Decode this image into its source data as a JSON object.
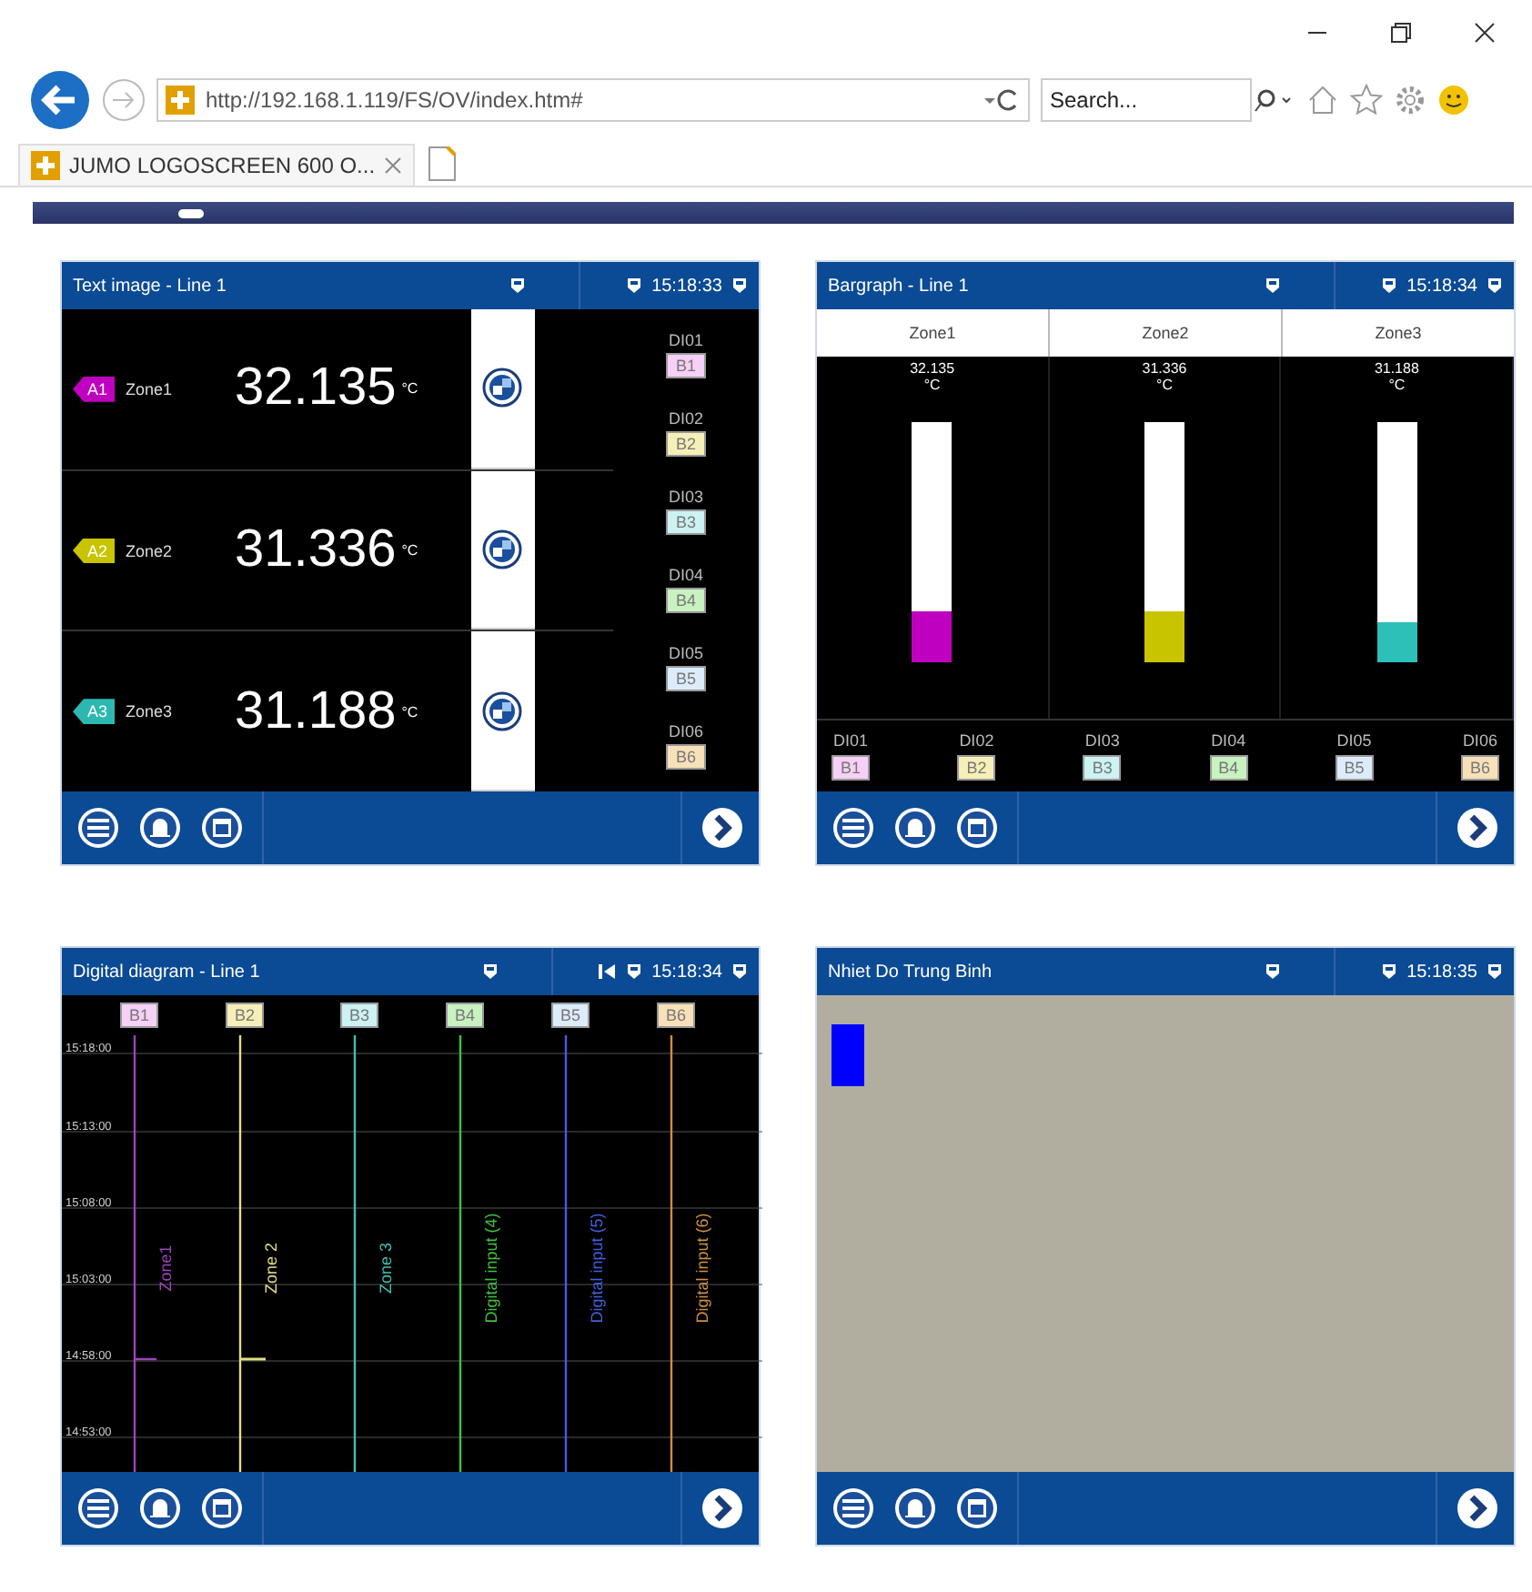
{
  "browser": {
    "url": "http://192.168.1.119/FS/OV/index.htm#",
    "search_placeholder": "Search...",
    "tab_title": "JUMO LOGOSCREEN 600 O..."
  },
  "panels": [
    {
      "kind": "text_image",
      "title": "Text image - Line 1",
      "time": "15:18:33",
      "skip_back": false,
      "rows": [
        {
          "tag": "A1",
          "name": "Zone1",
          "value": "32.135",
          "unit": "°C",
          "color": "#c000c0"
        },
        {
          "tag": "A2",
          "name": "Zone2",
          "value": "31.336",
          "unit": "°C",
          "color": "#c8c400"
        },
        {
          "tag": "A3",
          "name": "Zone3",
          "value": "31.188",
          "unit": "°C",
          "color": "#2cb8b0"
        }
      ],
      "inputs": [
        {
          "label": "DI01",
          "tag": "B1",
          "color": "#f6d0f6"
        },
        {
          "label": "DI02",
          "tag": "B2",
          "color": "#f6f0b8"
        },
        {
          "label": "DI03",
          "tag": "B3",
          "color": "#ccf2f2"
        },
        {
          "label": "DI04",
          "tag": "B4",
          "color": "#c8f2c0"
        },
        {
          "label": "DI05",
          "tag": "B5",
          "color": "#dcecfa"
        },
        {
          "label": "DI06",
          "tag": "B6",
          "color": "#f8e0b8"
        }
      ]
    },
    {
      "kind": "bargraph",
      "title": "Bargraph - Line 1",
      "time": "15:18:34",
      "skip_back": false,
      "zones": [
        {
          "name": "Zone1",
          "value": "32.135",
          "unit": "°C",
          "level": 0.21,
          "color": "#c000c0"
        },
        {
          "name": "Zone2",
          "value": "31.336",
          "unit": "°C",
          "level": 0.21,
          "color": "#c8c400"
        },
        {
          "name": "Zone3",
          "value": "31.188",
          "unit": "°C",
          "level": 0.17,
          "color": "#2cc0b8"
        }
      ],
      "inputs": [
        {
          "label": "DI01",
          "tag": "B1",
          "color": "#f6d0f6"
        },
        {
          "label": "DI02",
          "tag": "B2",
          "color": "#f6f0b8"
        },
        {
          "label": "DI03",
          "tag": "B3",
          "color": "#ccf2f2"
        },
        {
          "label": "DI04",
          "tag": "B4",
          "color": "#c8f2c0"
        },
        {
          "label": "DI05",
          "tag": "B5",
          "color": "#dcecfa"
        },
        {
          "label": "DI06",
          "tag": "B6",
          "color": "#f8e0b8"
        }
      ]
    },
    {
      "kind": "digital_diagram",
      "title": "Digital diagram - Line 1",
      "time": "15:18:34",
      "skip_back": true,
      "time_labels": [
        "15:18:00",
        "15:13:00",
        "15:08:00",
        "15:03:00",
        "14:58:00",
        "14:53:00"
      ],
      "traces": [
        {
          "tag": {
            "text": "B1",
            "color": "#f6d0f6"
          },
          "label": "Zone1",
          "color": "#a040c0"
        },
        {
          "tag": {
            "text": "B2",
            "color": "#f6f0b8"
          },
          "label": "Zone 2",
          "color": "#e0e080"
        },
        {
          "tag": {
            "text": "B3",
            "color": "#ccf2f2"
          },
          "label": "Zone 3",
          "color": "#40c0b0"
        },
        {
          "tag": {
            "text": "B4",
            "color": "#c8f2c0"
          },
          "label": "Digital input (4)",
          "color": "#40c040"
        },
        {
          "tag": {
            "text": "B5",
            "color": "#dcecfa"
          },
          "label": "Digital input (5)",
          "color": "#4060e0"
        },
        {
          "tag": {
            "text": "B6",
            "color": "#f8e0b8"
          },
          "label": "Digital input (6)",
          "color": "#d09040"
        }
      ]
    },
    {
      "kind": "canvas",
      "title": "Nhiet Do Trung Binh",
      "time": "15:18:35",
      "skip_back": false
    }
  ]
}
